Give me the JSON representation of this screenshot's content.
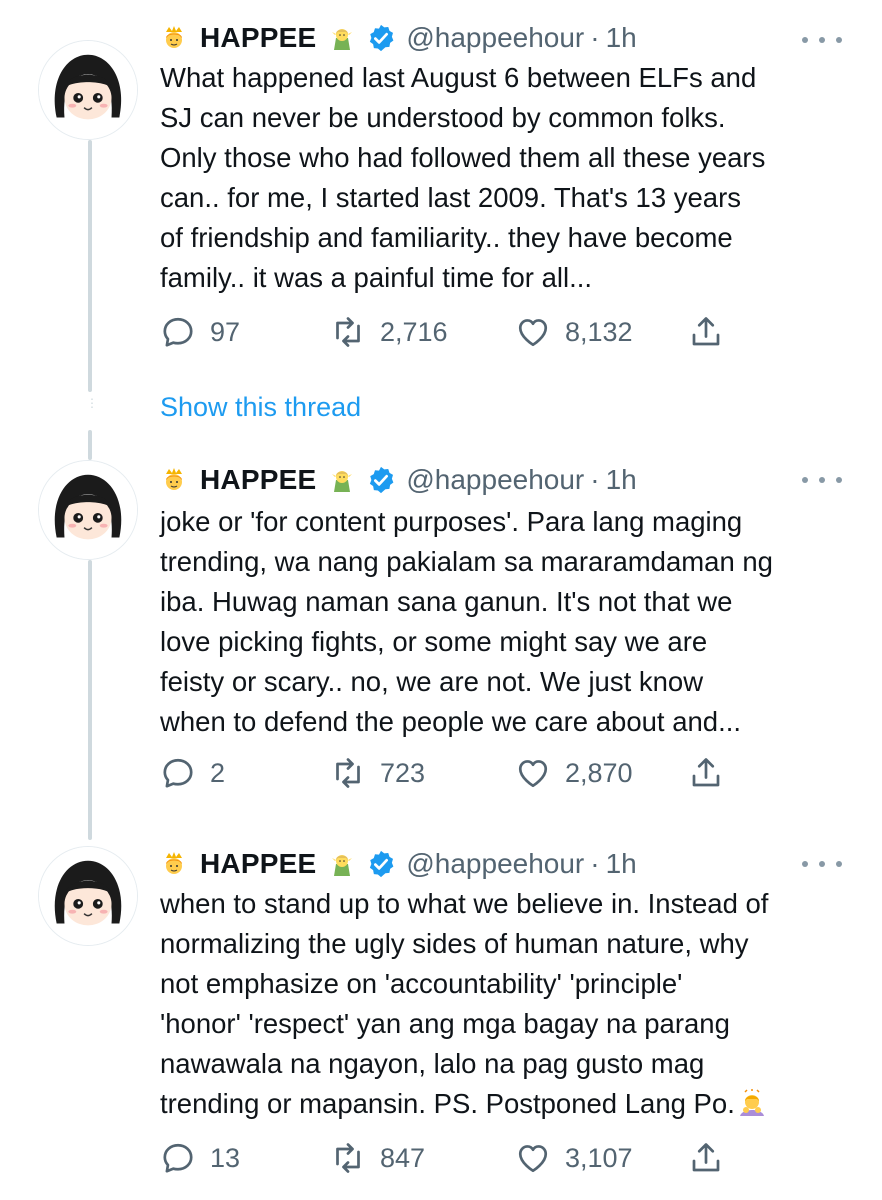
{
  "icons": {
    "reply": "reply-icon",
    "retweet": "retweet-icon",
    "like": "heart-icon",
    "share": "share-icon",
    "more": "more-icon",
    "verified": "verified-badge-icon"
  },
  "colors": {
    "link": "#1d9bf0",
    "verified": "#1d9bf0",
    "muted": "#536471",
    "thread_line": "#cfd9de"
  },
  "tweets": [
    {
      "name": "HAPPEE",
      "handle": "@happeehour",
      "sep": "·",
      "time": "1h",
      "lines": [
        "What happened last August 6 between ELFs and",
        "SJ can never be understood by common folks.",
        "Only those who had followed them all these years",
        "can.. for me, I started last 2009. That's 13 years",
        "of friendship and familiarity.. they have become",
        "family.. it was a painful time for all..."
      ],
      "replies": "97",
      "retweets": "2,716",
      "likes": "8,132"
    },
    {
      "name": "HAPPEE",
      "handle": "@happeehour",
      "sep": "·",
      "time": "1h",
      "lines": [
        "joke or 'for content purposes'. Para lang maging",
        "trending, wa nang pakialam sa mararamdaman ng",
        "iba. Huwag naman sana ganun. It's not that we",
        "love picking fights, or some might say we are",
        "feisty or scary.. no, we are not. We just know",
        "when to defend the people we care about and..."
      ],
      "replies": "2",
      "retweets": "723",
      "likes": "2,870"
    },
    {
      "name": "HAPPEE",
      "handle": "@happeehour",
      "sep": "·",
      "time": "1h",
      "lines": [
        "when to stand up to what we believe in. Instead of",
        "normalizing the ugly sides of human nature, why",
        "not emphasize on 'accountability' 'principle'",
        "'honor' 'respect' yan ang mga bagay na parang",
        "nawawala na ngayon, lalo na pag gusto mag",
        "trending or mapansin. PS. Postponed Lang Po."
      ],
      "replies": "13",
      "retweets": "847",
      "likes": "3,107"
    }
  ],
  "show_thread_label": "Show this thread"
}
